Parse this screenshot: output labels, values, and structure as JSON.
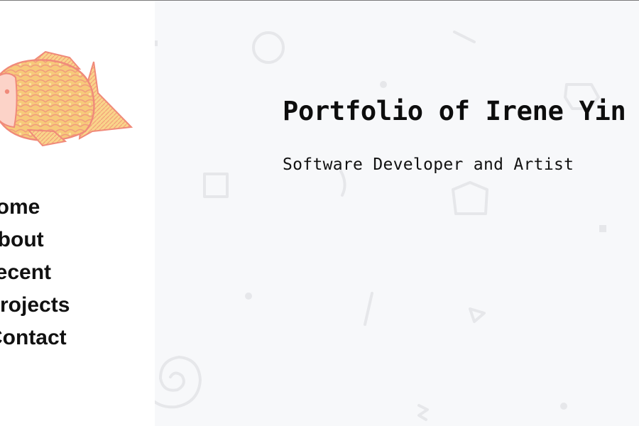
{
  "site": {
    "title": "Portfolio of Irene Yin",
    "subtitle": "Software Developer and Artist"
  },
  "nav": {
    "items": [
      {
        "label": "Home"
      },
      {
        "label": "About"
      },
      {
        "label": "Recent"
      },
      {
        "label": "Projects"
      },
      {
        "label": "Contact"
      }
    ]
  },
  "logo": {
    "icon": "koi-fish-icon",
    "colors": {
      "body": "#f7c97a",
      "outline": "#f08a7a",
      "highlight": "#fbe3a0"
    }
  },
  "theme": {
    "sidebar_bg": "#ffffff",
    "main_bg": "#f7f8fa",
    "decor_shape_color": "#e6e7ea"
  }
}
